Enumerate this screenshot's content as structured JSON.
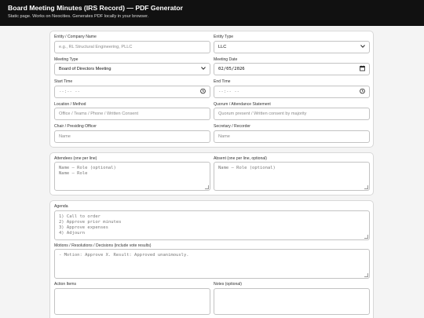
{
  "header": {
    "title": "Board Meeting Minutes (IRS Record) — PDF Generator",
    "subtitle": "Static page. Works on Neocities. Generates PDF locally in your browser."
  },
  "basics": {
    "entity_name": {
      "label": "Entity / Company Name",
      "placeholder": "e.g., RL Structural Engineering, PLLC"
    },
    "entity_type": {
      "label": "Entity Type",
      "value": "LLC",
      "icon": "chevron-down-icon"
    },
    "meeting_type": {
      "label": "Meeting Type",
      "value": "Board of Directors Meeting",
      "icon": "chevron-down-icon"
    },
    "meeting_date": {
      "label": "Meeting Date",
      "value": "02/05/2026",
      "icon": "calendar-icon"
    },
    "start_time": {
      "label": "Start Time",
      "value": "--:-- --",
      "icon": "clock-icon"
    },
    "end_time": {
      "label": "End Time",
      "value": "--:-- --",
      "icon": "clock-icon"
    },
    "location": {
      "label": "Location / Method",
      "placeholder": "Office / Teams / Phone / Written Consent"
    },
    "quorum": {
      "label": "Quorum / Attendance Statement",
      "placeholder": "Quorum present / Written consent by majority"
    },
    "chair": {
      "label": "Chair / Presiding Officer",
      "placeholder": "Name"
    },
    "secretary": {
      "label": "Secretary / Recorder",
      "placeholder": "Name"
    }
  },
  "attendance": {
    "attendees": {
      "label": "Attendees (one per line)",
      "placeholder": "Name — Role (optional)\nName — Role"
    },
    "absent": {
      "label": "Absent (one per line, optional)",
      "placeholder": "Name — Role (optional)"
    }
  },
  "agenda_section": {
    "agenda": {
      "label": "Agenda",
      "placeholder": "1) Call to order\n2) Approve prior minutes\n3) Approve expenses\n4) Adjourn"
    },
    "motions": {
      "label": "Motions / Resolutions / Decisions (include vote results)",
      "placeholder": "- Motion: Approve X. Result: Approved unanimously."
    },
    "action_items": {
      "label": "Action Items"
    },
    "notes": {
      "label": "Notes (optional)"
    }
  }
}
